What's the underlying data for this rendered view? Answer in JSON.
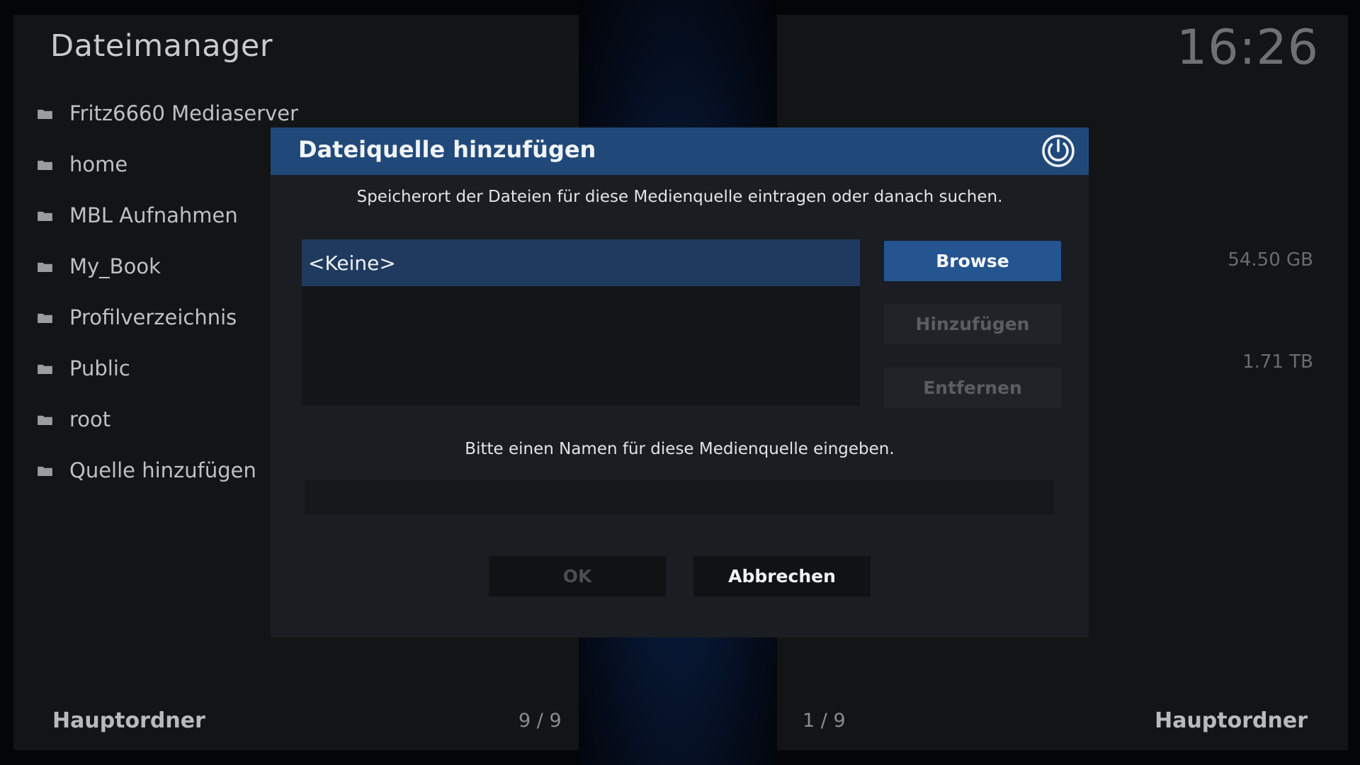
{
  "app": {
    "title": "Dateimanager",
    "clock": "16:26"
  },
  "left_panel": {
    "items": [
      {
        "label": "Fritz6660 Mediaserver",
        "icon": "folder-icon"
      },
      {
        "label": "home",
        "icon": "folder-icon"
      },
      {
        "label": "MBL Aufnahmen",
        "icon": "folder-icon"
      },
      {
        "label": "My_Book",
        "icon": "folder-icon"
      },
      {
        "label": "Profilverzeichnis",
        "icon": "folder-icon"
      },
      {
        "label": "Public",
        "icon": "folder-icon"
      },
      {
        "label": "root",
        "icon": "folder-icon"
      },
      {
        "label": "Quelle hinzufügen",
        "icon": "folder-icon"
      }
    ],
    "footer_label": "Hauptordner",
    "footer_count": "9 / 9"
  },
  "right_panel": {
    "sizes": [
      "54.50 GB",
      "1.71 TB"
    ],
    "footer_label": "Hauptordner",
    "footer_count": "1 / 9"
  },
  "dialog": {
    "title": "Dateiquelle hinzufügen",
    "description": "Speicherort der Dateien für diese Medienquelle eintragen oder danach suchen.",
    "path_items": [
      "<Keine>"
    ],
    "browse_label": "Browse",
    "add_label": "Hinzufügen",
    "remove_label": "Entfernen",
    "name_prompt": "Bitte einen Namen für diese Medienquelle eingeben.",
    "name_value": "",
    "ok_label": "OK",
    "cancel_label": "Abbrechen"
  },
  "colors": {
    "dialog_header": "#20497a",
    "accent_button": "#255590",
    "selected_item": "#1f3a5e"
  }
}
